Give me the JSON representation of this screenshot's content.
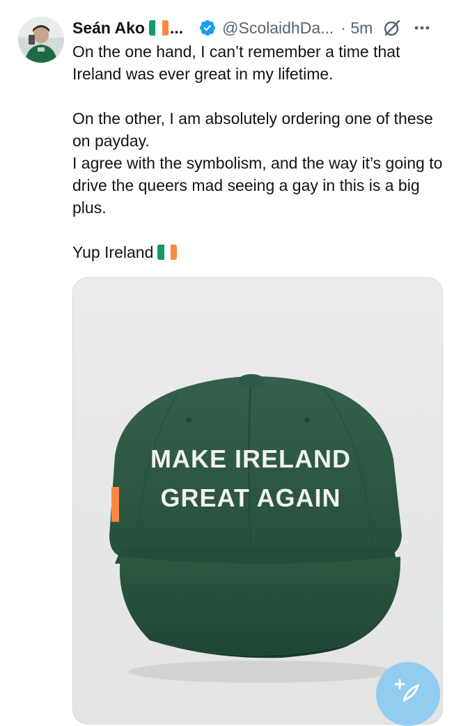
{
  "author": {
    "name": "Seán Ako",
    "ellipsis": "...",
    "handle": "@ScolaidhDa...",
    "time": "· 5m"
  },
  "icons": {
    "verified": "verified-badge-icon",
    "grok": "grok-icon",
    "more": "more-options-icon",
    "compose": "compose-post-icon"
  },
  "colors": {
    "flag_green": "#169b62",
    "flag_white": "#ffffff",
    "flag_orange": "#ff883e",
    "verified_blue": "#1d9bf0",
    "cap_green": "#2e5a45",
    "fab_blue": "#8ccbf2"
  },
  "post": {
    "paragraph1": "On the one hand, I can’t remember a time that Ireland was ever great in my lifetime.",
    "paragraph2_line1": "On the other, I am absolutely ordering one of these on payday.",
    "paragraph2_line2": "I agree with the symbolism, and the way it’s going to drive the queers mad seeing a gay in this is a big plus.",
    "paragraph3": "Yup Ireland"
  },
  "media": {
    "cap_line1": "MAKE IRELAND",
    "cap_line2": "GREAT AGAIN"
  }
}
